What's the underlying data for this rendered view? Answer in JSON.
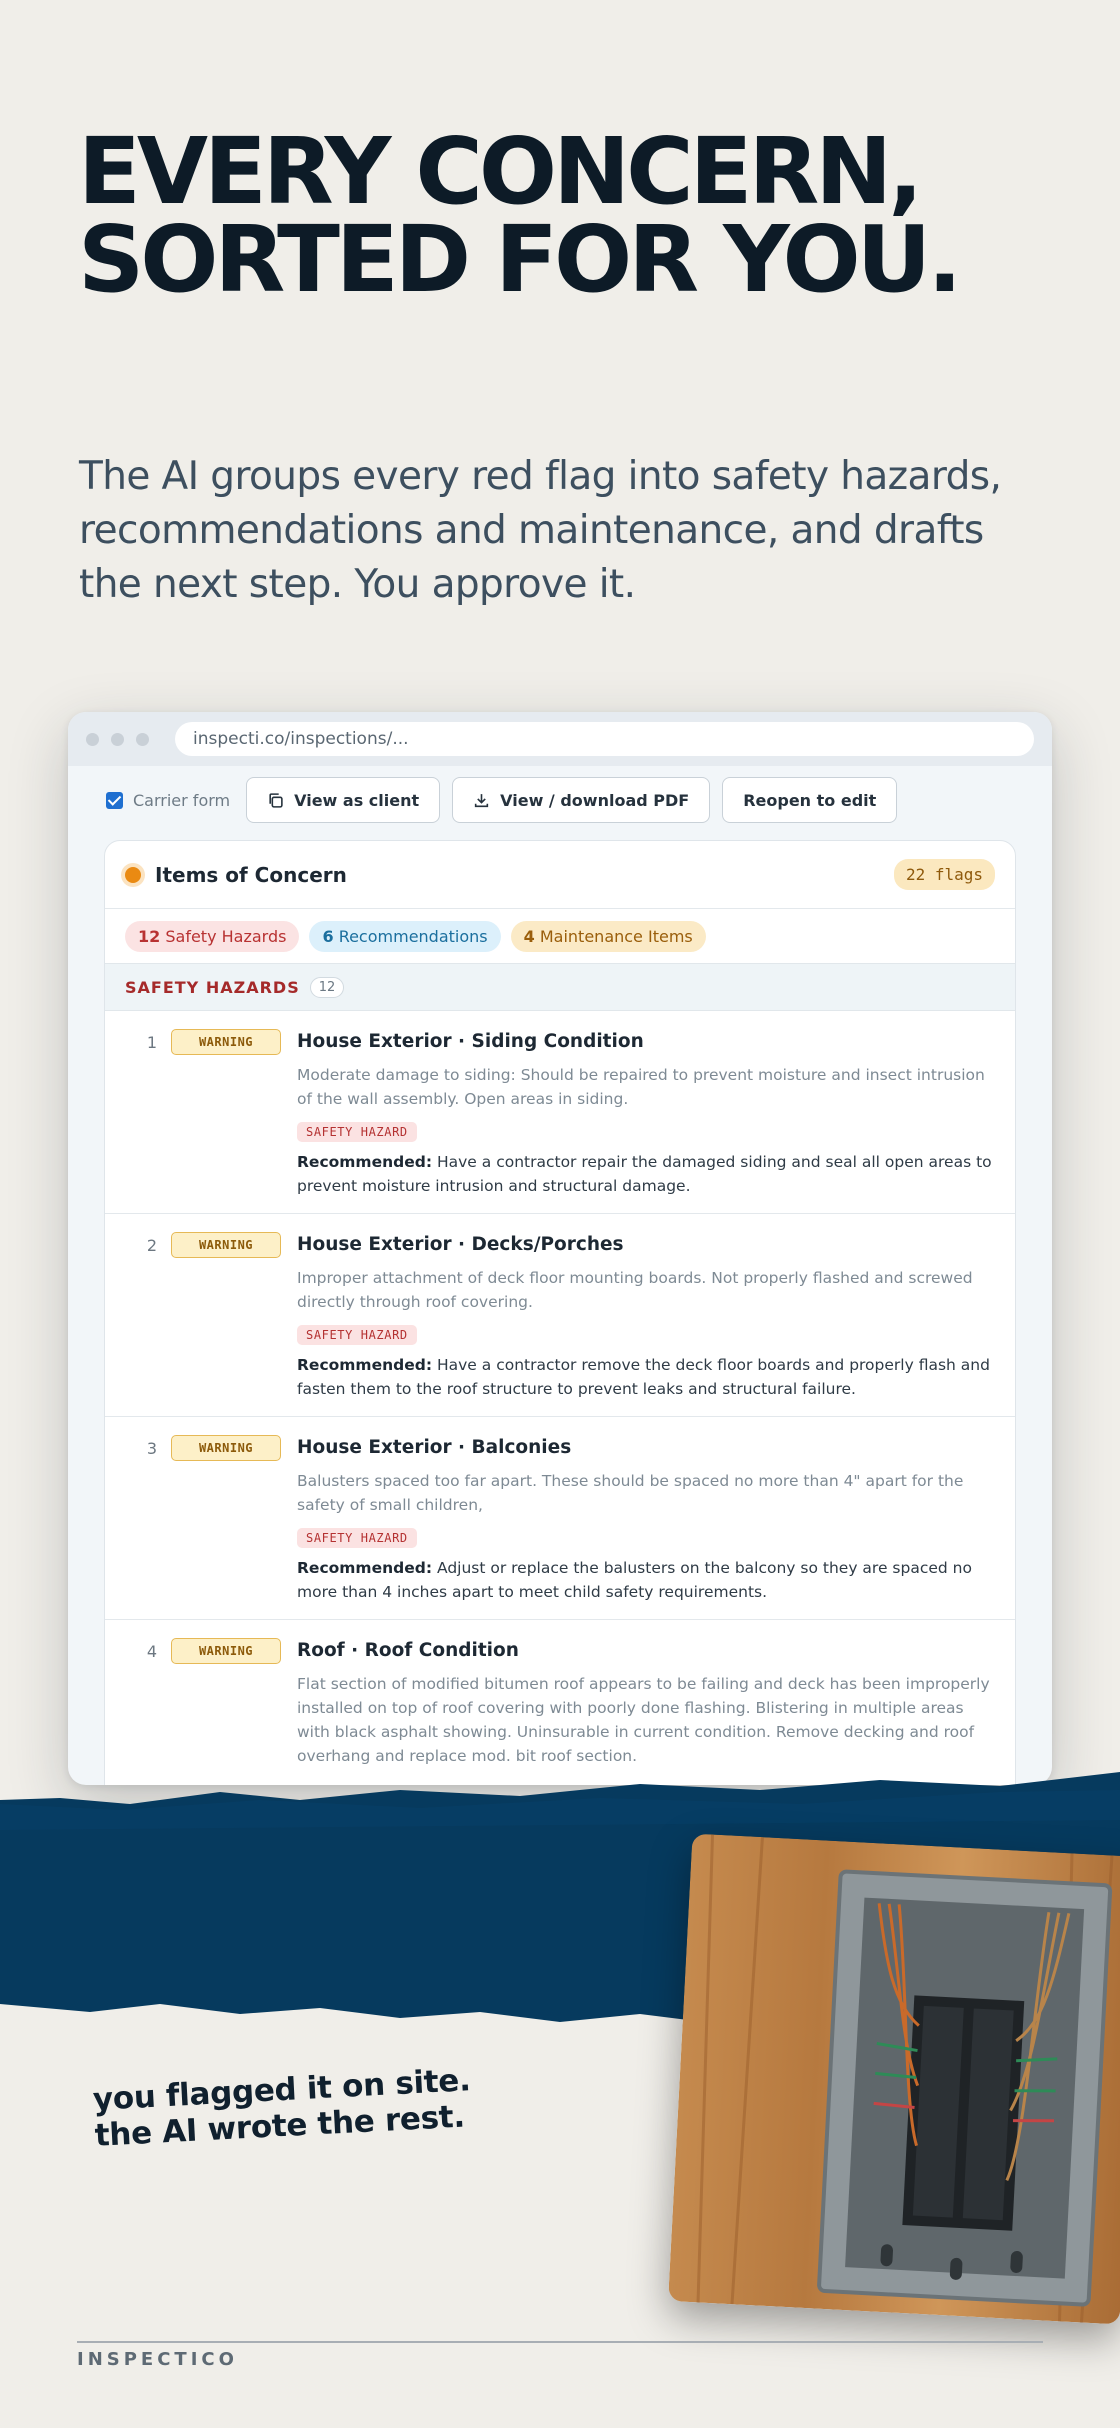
{
  "hero": {
    "line1": "EVERY CONCERN,",
    "line2": "SORTED FOR YOU.",
    "subhead": "The AI groups every red flag into safety hazards, recommendations and maintenance, and drafts the next step. You approve it."
  },
  "browser": {
    "url": "inspecti.co/inspections/...",
    "carrier_form_label": "Carrier form",
    "carrier_form_checked": true,
    "view_as_client": "View as client",
    "view_pdf": "View / download PDF",
    "reopen": "Reopen to edit"
  },
  "concerns": {
    "title": "Items of Concern",
    "flags": "22 flags",
    "pills": [
      {
        "count": "12",
        "label": "Safety Hazards"
      },
      {
        "count": "6",
        "label": "Recommendations"
      },
      {
        "count": "4",
        "label": "Maintenance Items"
      }
    ],
    "section_title": "SAFETY HAZARDS",
    "section_count": "12",
    "items": [
      {
        "num": "1",
        "badge": "WARNING",
        "title": "House Exterior · Siding Condition",
        "desc": "Moderate damage to siding: Should be repaired to prevent moisture and insect intrusion of the wall assembly. Open areas in siding.",
        "tag": "SAFETY HAZARD",
        "rec_label": "Recommended:",
        "rec": "Have a contractor repair the damaged siding and seal all open areas to prevent moisture intrusion and structural damage."
      },
      {
        "num": "2",
        "badge": "WARNING",
        "title": "House Exterior · Decks/Porches",
        "desc": "Improper attachment of deck floor mounting boards. Not properly flashed and screwed directly through roof covering.",
        "tag": "SAFETY HAZARD",
        "rec_label": "Recommended:",
        "rec": "Have a contractor remove the deck floor boards and properly flash and fasten them to the roof structure to prevent leaks and structural failure."
      },
      {
        "num": "3",
        "badge": "WARNING",
        "title": "House Exterior · Balconies",
        "desc": "Balusters spaced too far apart. These should be spaced no more than 4\" apart for the safety of small children,",
        "tag": "SAFETY HAZARD",
        "rec_label": "Recommended:",
        "rec": "Adjust or replace the balusters on the balcony so they are spaced no more than 4 inches apart to meet child safety requirements."
      },
      {
        "num": "4",
        "badge": "WARNING",
        "title": "Roof · Roof Condition",
        "desc": "Flat section of modified bitumen roof appears to be failing and deck has been improperly installed on top of roof covering with poorly done flashing. Blistering in multiple areas with black asphalt showing. Uninsurable in current condition. Remove decking and roof overhang and replace mod. bit roof section."
      }
    ]
  },
  "tagline": {
    "line1": "you flagged it on site.",
    "line2": "the AI wrote the rest."
  },
  "footer": {
    "brand": "INSPECTICO"
  },
  "colors": {
    "background": "#f0eee9",
    "navy_band": "#063a5e",
    "headline": "#0d1b27",
    "safety_red": "#a52a2a",
    "warning_amber": "#e6b956"
  }
}
